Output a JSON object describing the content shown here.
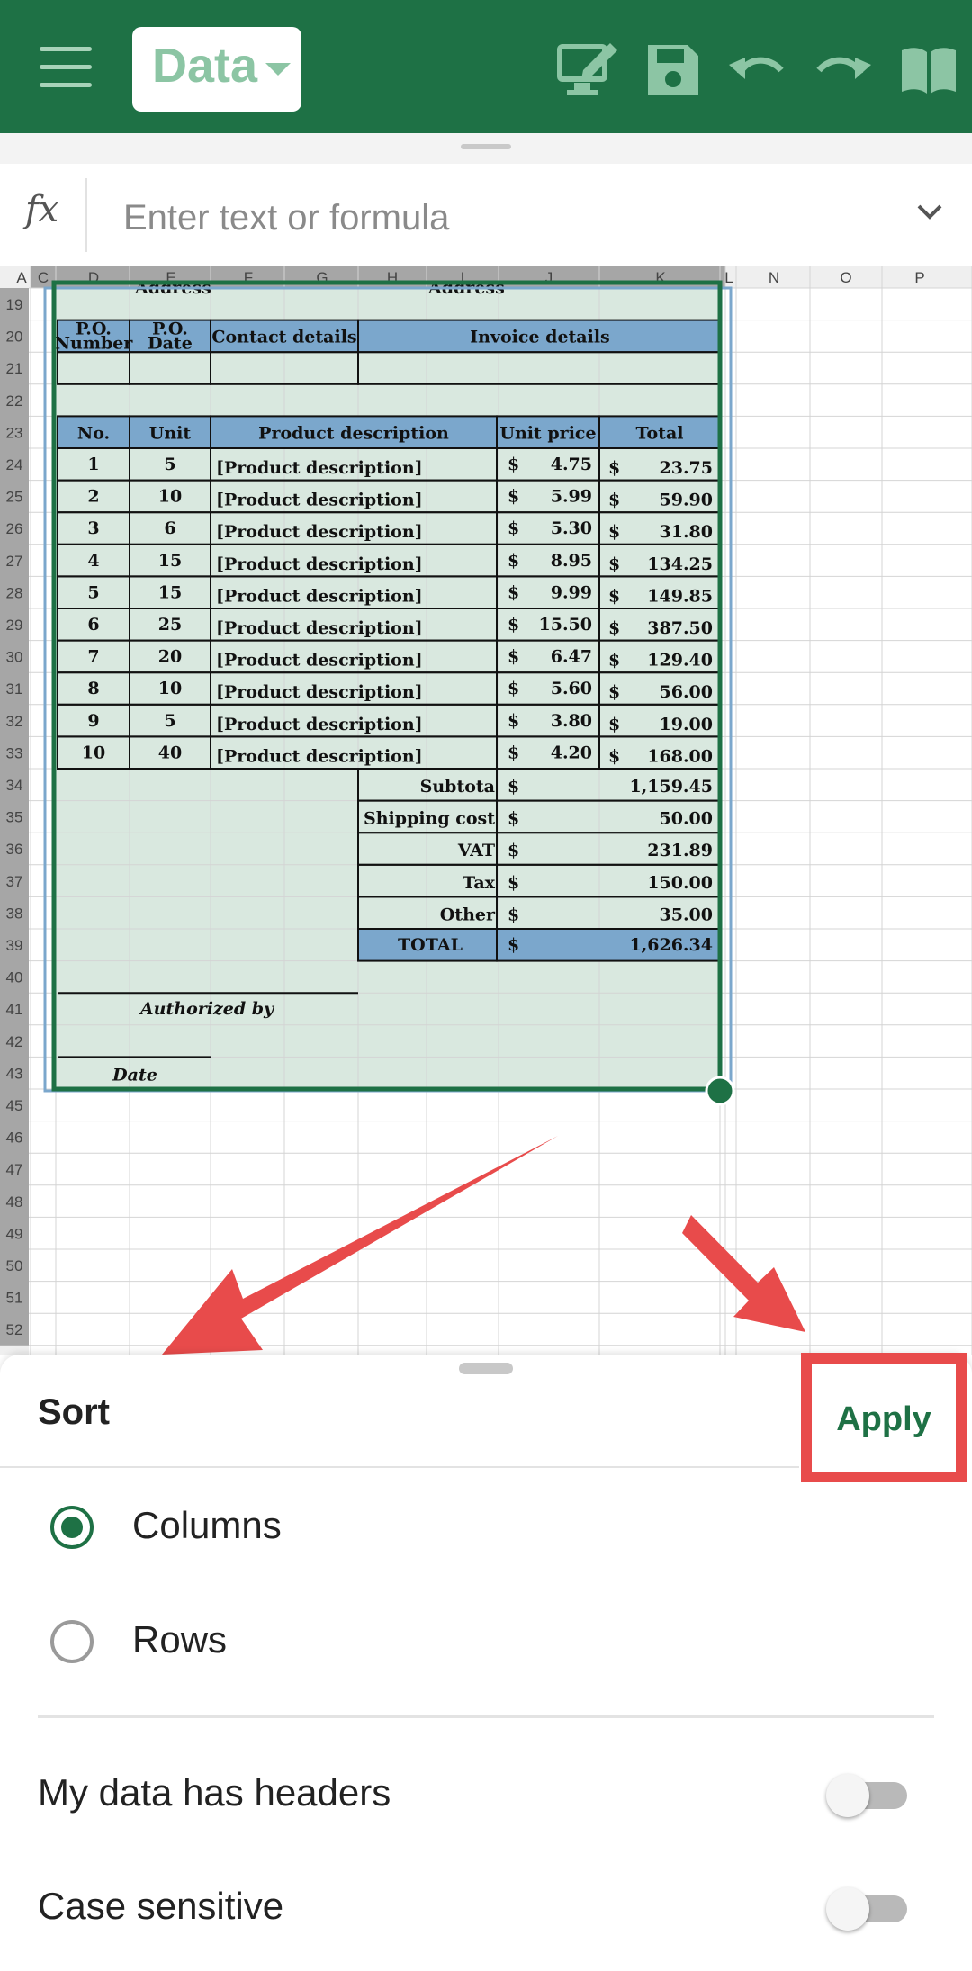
{
  "toolbar": {
    "menu_icon": "hamburger-icon",
    "mode_label": "Data",
    "icons": [
      "desktop-edit-icon",
      "save-icon",
      "undo-icon",
      "redo-icon",
      "reading-view-icon"
    ]
  },
  "formula_bar": {
    "fx_label": "fx",
    "placeholder": "Enter text or formula"
  },
  "sheet": {
    "column_headers": [
      "A",
      "C",
      "D",
      "E",
      "F",
      "G",
      "H",
      "I",
      "J",
      "K",
      "L",
      "N",
      "O",
      "P"
    ],
    "row_numbers": [
      "19",
      "20",
      "21",
      "22",
      "23",
      "24",
      "25",
      "26",
      "27",
      "28",
      "29",
      "30",
      "31",
      "32",
      "33",
      "34",
      "35",
      "36",
      "37",
      "38",
      "39",
      "40",
      "41",
      "42",
      "43",
      "45",
      "46",
      "47",
      "48",
      "49",
      "50",
      "51",
      "52"
    ],
    "address_label": "Address",
    "po_headers": [
      "P.O. Number",
      "P.O. Date",
      "Contact details",
      "Invoice details"
    ],
    "item_headers": [
      "No.",
      "Unit",
      "Product description",
      "Unit price",
      "Total"
    ],
    "items": [
      {
        "no": "1",
        "unit": "5",
        "desc": "[Product description]",
        "price": "4.75",
        "total": "23.75"
      },
      {
        "no": "2",
        "unit": "10",
        "desc": "[Product description]",
        "price": "5.99",
        "total": "59.90"
      },
      {
        "no": "3",
        "unit": "6",
        "desc": "[Product description]",
        "price": "5.30",
        "total": "31.80"
      },
      {
        "no": "4",
        "unit": "15",
        "desc": "[Product description]",
        "price": "8.95",
        "total": "134.25"
      },
      {
        "no": "5",
        "unit": "15",
        "desc": "[Product description]",
        "price": "9.99",
        "total": "149.85"
      },
      {
        "no": "6",
        "unit": "25",
        "desc": "[Product description]",
        "price": "15.50",
        "total": "387.50"
      },
      {
        "no": "7",
        "unit": "20",
        "desc": "[Product description]",
        "price": "6.47",
        "total": "129.40"
      },
      {
        "no": "8",
        "unit": "10",
        "desc": "[Product description]",
        "price": "5.60",
        "total": "56.00"
      },
      {
        "no": "9",
        "unit": "5",
        "desc": "[Product description]",
        "price": "3.80",
        "total": "19.00"
      },
      {
        "no": "10",
        "unit": "40",
        "desc": "[Product description]",
        "price": "4.20",
        "total": "168.00"
      }
    ],
    "summary": [
      {
        "label": "Subtota",
        "value": "1,159.45"
      },
      {
        "label": "Shipping cost",
        "value": "50.00"
      },
      {
        "label": "VAT",
        "value": "231.89"
      },
      {
        "label": "Tax",
        "value": "150.00"
      },
      {
        "label": "Other",
        "value": "35.00"
      }
    ],
    "total_label": "TOTAL",
    "total_value": "1,626.34",
    "currency": "$",
    "authorized_by": "Authorized by",
    "date_label": "Date",
    "colors": {
      "header_fill": "#7ba7cc",
      "cell_fill": "#d9e8df",
      "selection": "#1e7145",
      "grid": "#d4d4d4"
    }
  },
  "sort_panel": {
    "title": "Sort",
    "apply_label": "Apply",
    "options": [
      {
        "label": "Columns",
        "selected": true
      },
      {
        "label": "Rows",
        "selected": false
      }
    ],
    "toggles": [
      {
        "label": "My data has headers",
        "on": false
      },
      {
        "label": "Case sensitive",
        "on": false
      }
    ]
  },
  "annotation_color": "#e84b4b"
}
